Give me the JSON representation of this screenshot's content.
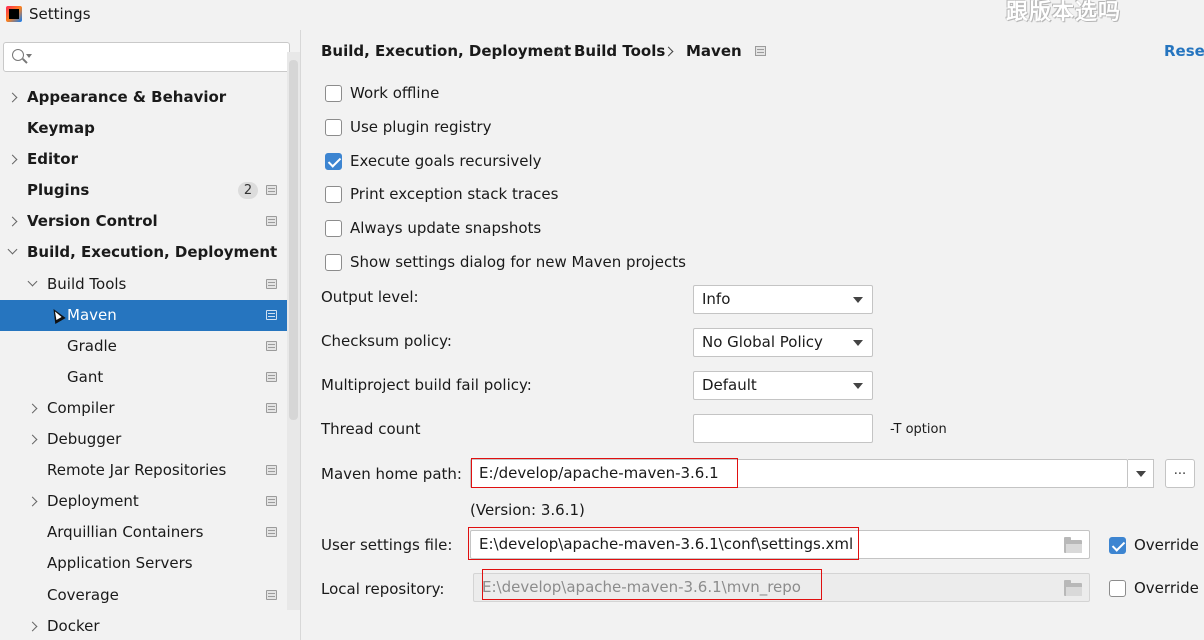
{
  "window": {
    "title": "Settings",
    "watermark": "跟版本选吗"
  },
  "sidebar": {
    "search_placeholder": "",
    "items": [
      {
        "label": "Appearance & Behavior",
        "bold": true,
        "level": 0,
        "expand": "right",
        "badge": "",
        "project_icon": false,
        "selected": false
      },
      {
        "label": "Keymap",
        "bold": true,
        "level": 0,
        "expand": "none",
        "badge": "",
        "project_icon": false,
        "selected": false
      },
      {
        "label": "Editor",
        "bold": true,
        "level": 0,
        "expand": "right",
        "badge": "",
        "project_icon": false,
        "selected": false
      },
      {
        "label": "Plugins",
        "bold": true,
        "level": 0,
        "expand": "none",
        "badge": "2",
        "project_icon": true,
        "selected": false
      },
      {
        "label": "Version Control",
        "bold": true,
        "level": 0,
        "expand": "right",
        "badge": "",
        "project_icon": true,
        "selected": false
      },
      {
        "label": "Build, Execution, Deployment",
        "bold": true,
        "level": 0,
        "expand": "down",
        "badge": "",
        "project_icon": false,
        "selected": false
      },
      {
        "label": "Build Tools",
        "bold": false,
        "level": 1,
        "expand": "down",
        "badge": "",
        "project_icon": true,
        "selected": false
      },
      {
        "label": "Maven",
        "bold": false,
        "level": 2,
        "expand": "none",
        "badge": "",
        "project_icon": true,
        "selected": true
      },
      {
        "label": "Gradle",
        "bold": false,
        "level": 2,
        "expand": "none",
        "badge": "",
        "project_icon": true,
        "selected": false
      },
      {
        "label": "Gant",
        "bold": false,
        "level": 2,
        "expand": "none",
        "badge": "",
        "project_icon": true,
        "selected": false
      },
      {
        "label": "Compiler",
        "bold": false,
        "level": 1,
        "expand": "right",
        "badge": "",
        "project_icon": true,
        "selected": false
      },
      {
        "label": "Debugger",
        "bold": false,
        "level": 1,
        "expand": "right",
        "badge": "",
        "project_icon": false,
        "selected": false
      },
      {
        "label": "Remote Jar Repositories",
        "bold": false,
        "level": 1,
        "expand": "none",
        "badge": "",
        "project_icon": true,
        "selected": false
      },
      {
        "label": "Deployment",
        "bold": false,
        "level": 1,
        "expand": "right",
        "badge": "",
        "project_icon": true,
        "selected": false
      },
      {
        "label": "Arquillian Containers",
        "bold": false,
        "level": 1,
        "expand": "none",
        "badge": "",
        "project_icon": true,
        "selected": false
      },
      {
        "label": "Application Servers",
        "bold": false,
        "level": 1,
        "expand": "none",
        "badge": "",
        "project_icon": false,
        "selected": false
      },
      {
        "label": "Coverage",
        "bold": false,
        "level": 1,
        "expand": "none",
        "badge": "",
        "project_icon": true,
        "selected": false
      },
      {
        "label": "Docker",
        "bold": false,
        "level": 1,
        "expand": "right",
        "badge": "",
        "project_icon": false,
        "selected": false
      }
    ]
  },
  "breadcrumb": [
    "Build, Execution, Deployment",
    "Build Tools",
    "Maven"
  ],
  "reset_label": "Reset",
  "checkboxes": [
    {
      "label": "Work offline",
      "checked": false
    },
    {
      "label": "Use plugin registry",
      "checked": false
    },
    {
      "label": "Execute goals recursively",
      "checked": true
    },
    {
      "label": "Print exception stack traces",
      "checked": false
    },
    {
      "label": "Always update snapshots",
      "checked": false
    },
    {
      "label": "Show settings dialog for new Maven projects",
      "checked": false
    }
  ],
  "fields": {
    "output_level": {
      "label": "Output level:",
      "value": "Info"
    },
    "checksum_policy": {
      "label": "Checksum policy:",
      "value": "No Global Policy"
    },
    "multiproject_fail": {
      "label": "Multiproject build fail policy:",
      "value": "Default"
    },
    "thread_count": {
      "label": "Thread count",
      "value": "",
      "hint": "-T option"
    },
    "maven_home": {
      "label": "Maven home path:",
      "value": "E:/develop/apache-maven-3.6.1",
      "version": "(Version: 3.6.1)",
      "browse_label": "..."
    },
    "user_settings": {
      "label": "User settings file:",
      "value": "E:\\develop\\apache-maven-3.6.1\\conf\\settings.xml",
      "override_label": "Override",
      "override_checked": true
    },
    "local_repo": {
      "label": "Local repository:",
      "value": "E:\\develop\\apache-maven-3.6.1\\mvn_repo",
      "override_label": "Override",
      "override_checked": false
    }
  },
  "colors": {
    "selection": "#2675bf",
    "link": "#2675bf",
    "highlight_box": "#e01010",
    "checkbox_checked": "#3d85d1"
  }
}
